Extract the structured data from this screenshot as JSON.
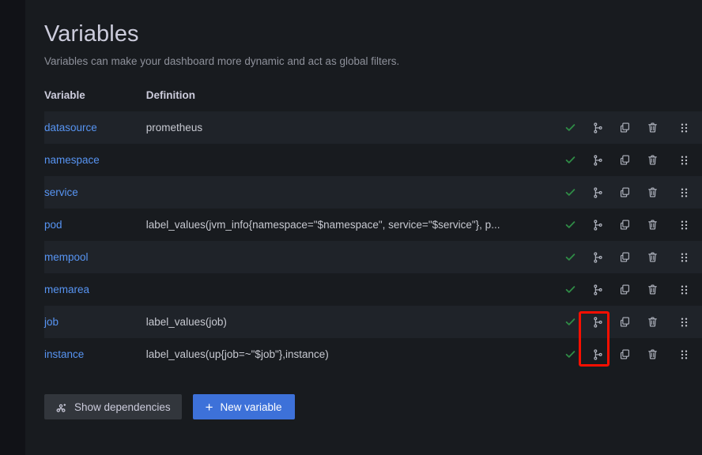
{
  "page": {
    "title": "Variables",
    "subtitle": "Variables can make your dashboard more dynamic and act as global filters."
  },
  "table": {
    "headers": {
      "variable": "Variable",
      "definition": "Definition"
    },
    "rows": [
      {
        "name": "datasource",
        "definition": "prometheus"
      },
      {
        "name": "namespace",
        "definition": ""
      },
      {
        "name": "service",
        "definition": ""
      },
      {
        "name": "pod",
        "definition": "label_values(jvm_info{namespace=\"$namespace\", service=\"$service\"}, p..."
      },
      {
        "name": "mempool",
        "definition": ""
      },
      {
        "name": "memarea",
        "definition": ""
      },
      {
        "name": "job",
        "definition": "label_values(job)"
      },
      {
        "name": "instance",
        "definition": "label_values(up{job=~\"$job\"},instance)"
      }
    ],
    "row_actions": {
      "check": "check-icon",
      "dependencies": "code-branch-icon",
      "duplicate": "copy-icon",
      "delete": "trash-icon",
      "drag": "drag-handle-icon"
    }
  },
  "footer": {
    "show_dependencies_label": "Show dependencies",
    "new_variable_label": "New variable",
    "new_variable_plus": "+"
  },
  "colors": {
    "panel_bg": "#181b1f",
    "page_bg": "#111217",
    "row_alt_bg": "#1f2329",
    "link": "#5794f2",
    "check_green": "#2f8b46",
    "primary_button": "#3d71d9",
    "secondary_button": "#32363c",
    "highlight_outline": "#fa0f00",
    "text_primary": "#ccccdc",
    "text_secondary": "#8e919b"
  },
  "annotation": {
    "highlight_target": "check-icons-for-job-and-instance-rows"
  }
}
